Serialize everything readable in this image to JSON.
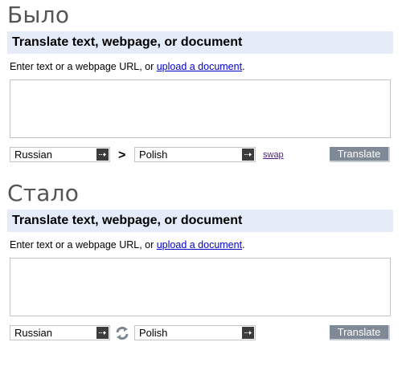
{
  "before": {
    "heading": "Было",
    "bar_title": "Translate text, webpage, or document",
    "intro_text": "Enter text or a webpage URL, or ",
    "intro_link": "upload a document",
    "intro_end": ".",
    "source_language": "Russian",
    "target_language": "Polish",
    "direction_symbol": ">",
    "swap_label": "swap",
    "translate_button": "Translate"
  },
  "after": {
    "heading": "Стало",
    "bar_title": "Translate text, webpage, or document",
    "intro_text": "Enter text or a webpage URL, or ",
    "intro_link": "upload a document",
    "intro_end": ".",
    "source_language": "Russian",
    "target_language": "Polish",
    "swap_icon": "swap-arrows-icon",
    "translate_button": "Translate"
  },
  "colors": {
    "bar_background": "#e5ecf9",
    "link": "#0000cc",
    "visited_link": "#551a8b",
    "button": "#7f8a96"
  }
}
